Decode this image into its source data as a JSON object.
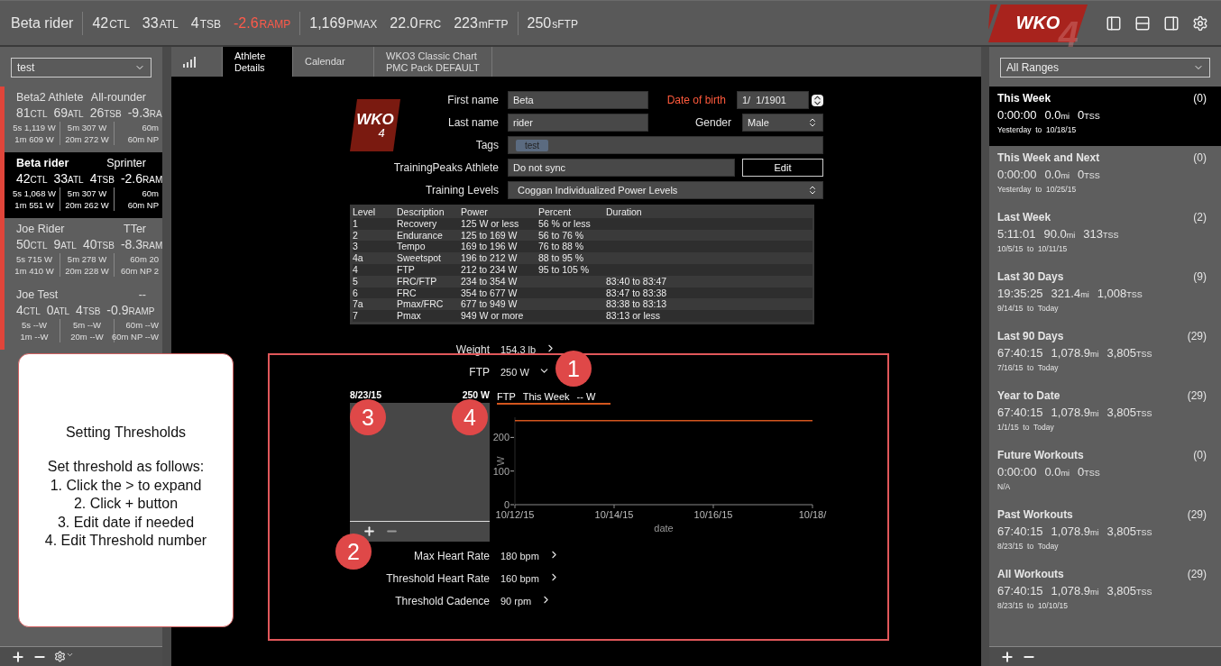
{
  "top_bar": {
    "athlete": "Beta rider",
    "metric_groups": [
      [
        {
          "value": "42",
          "unit": "CTL",
          "alert": false
        },
        {
          "value": "33",
          "unit": "ATL",
          "alert": false
        },
        {
          "value": "4",
          "unit": "TSB",
          "alert": false
        },
        {
          "value": "-2.6",
          "unit": "RAMP",
          "alert": true
        }
      ],
      [
        {
          "value": "1,169",
          "unit": "PMAX",
          "alert": false
        },
        {
          "value": "22.0",
          "unit": "FRC",
          "alert": false
        },
        {
          "value": "223",
          "unit": "mFTP",
          "alert": false
        }
      ],
      [
        {
          "value": "250",
          "unit": "sFTP",
          "alert": false
        }
      ]
    ],
    "logo": {
      "text": "WKO",
      "mark": "4"
    }
  },
  "left_sidebar": {
    "filter": "test",
    "athletes": [
      {
        "name": "Beta2 Athlete",
        "type": "All-rounder",
        "selected": false,
        "stats": [
          {
            "value": "81",
            "unit": "CTL"
          },
          {
            "value": "69",
            "unit": "ATL"
          },
          {
            "value": "26",
            "unit": "TSB"
          },
          {
            "value": "-9.3",
            "unit": "RA"
          }
        ],
        "powers": [
          [
            "5s 1,119 W",
            "1m 609 W"
          ],
          [
            "5m 307 W",
            "20m 272 W"
          ],
          [
            "60m",
            "60m NP"
          ]
        ]
      },
      {
        "name": "Beta rider",
        "type": "Sprinter",
        "selected": true,
        "stats": [
          {
            "value": "42",
            "unit": "CTL"
          },
          {
            "value": "33",
            "unit": "ATL"
          },
          {
            "value": "4",
            "unit": "TSB"
          },
          {
            "value": "-2.6",
            "unit": "RAM"
          }
        ],
        "powers": [
          [
            "5s 1,068 W",
            "1m 551 W"
          ],
          [
            "5m 307 W",
            "20m 262 W"
          ],
          [
            "60m",
            "60m NP"
          ]
        ]
      },
      {
        "name": "Joe Rider",
        "type": "TTer",
        "selected": false,
        "stats": [
          {
            "value": "50",
            "unit": "CTL"
          },
          {
            "value": "9",
            "unit": "ATL"
          },
          {
            "value": "40",
            "unit": "TSB"
          },
          {
            "value": "-8.3",
            "unit": "RAM"
          }
        ],
        "powers": [
          [
            "5s 715 W",
            "1m 410 W"
          ],
          [
            "5m 278 W",
            "20m 228 W"
          ],
          [
            "60m 20",
            "60m NP 2"
          ]
        ]
      },
      {
        "name": "Joe Test",
        "type": "--",
        "selected": false,
        "stats": [
          {
            "value": "4",
            "unit": "CTL"
          },
          {
            "value": "0",
            "unit": "ATL"
          },
          {
            "value": "4",
            "unit": "TSB"
          },
          {
            "value": "-0.9",
            "unit": "RAMP"
          }
        ],
        "powers": [
          [
            "5s --W",
            "1m --W"
          ],
          [
            "5m --W",
            "20m --W"
          ],
          [
            "60m --W",
            "60m NP --W"
          ]
        ]
      }
    ]
  },
  "tabs": [
    {
      "kind": "icon",
      "selected": false
    },
    {
      "kind": "text",
      "label": "Athlete\nDetails",
      "selected": true
    },
    {
      "kind": "text",
      "label": "Calendar",
      "selected": false
    },
    {
      "kind": "text",
      "label": "WKO3 Classic Chart\nPMC Pack DEFAULT",
      "selected": false
    }
  ],
  "athlete_details": {
    "logo": {
      "text": "WKO",
      "mark": "4"
    },
    "first_name": {
      "label": "First name",
      "value": "Beta"
    },
    "date_of_birth": {
      "label": "Date of birth",
      "value": "1/  1/1901"
    },
    "last_name": {
      "label": "Last name",
      "value": "rider"
    },
    "gender": {
      "label": "Gender",
      "value": "Male"
    },
    "tags": {
      "label": "Tags",
      "chips": [
        "test"
      ]
    },
    "trainingpeaks": {
      "label": "TrainingPeaks Athlete",
      "value": "Do not sync",
      "button": "Edit"
    },
    "training_levels": {
      "label": "Training Levels",
      "value": "Coggan Individualized Power Levels"
    },
    "levels_table": {
      "columns": [
        "Level",
        "Description",
        "Power",
        "Percent",
        "Duration"
      ],
      "rows": [
        [
          "1",
          "Recovery",
          "125 W or less",
          "56 % or less",
          ""
        ],
        [
          "2",
          "Endurance",
          "125 to 169 W",
          "56 to 76 %",
          ""
        ],
        [
          "3",
          "Tempo",
          "169 to 196 W",
          "76 to 88 %",
          ""
        ],
        [
          "4a",
          "Sweetspot",
          "196 to 212 W",
          "88 to 95 %",
          ""
        ],
        [
          "4",
          "FTP",
          "212 to 234 W",
          "95 to 105 %",
          ""
        ],
        [
          "5",
          "FRC/FTP",
          "234 to 354 W",
          "",
          "83:40 to 83:47"
        ],
        [
          "6",
          "FRC",
          "354 to 677 W",
          "",
          "83:47 to 83:38"
        ],
        [
          "7a",
          "Pmax/FRC",
          "677 to 949 W",
          "",
          "83:38 to 83:13"
        ],
        [
          "7",
          "Pmax",
          "949 W or more",
          "",
          "83:13 or less"
        ]
      ]
    },
    "weight": {
      "label": "Weight",
      "value": "154.3 lb",
      "expanded": false
    },
    "ftp": {
      "label": "FTP",
      "value": "250 W",
      "expanded": true,
      "history": {
        "date": "8/23/15",
        "value": "250 W"
      },
      "legend": {
        "range": "This Week",
        "value": "-- W"
      },
      "chart_data": {
        "type": "line",
        "xlabel": "date",
        "ylabel": "W",
        "x": [
          "10/12/15",
          "10/14/15",
          "10/16/15",
          "10/18/"
        ],
        "ylim": [
          0,
          260
        ],
        "yticks": [
          0,
          100,
          200
        ],
        "series": [
          {
            "name": "FTP",
            "color": "#d4561e",
            "values": [
              250,
              250,
              250,
              250
            ]
          }
        ]
      }
    },
    "thresholds": [
      {
        "label": "Max Heart Rate",
        "value": "180 bpm",
        "expanded": false
      },
      {
        "label": "Threshold Heart Rate",
        "value": "160 bpm",
        "expanded": false
      },
      {
        "label": "Threshold Cadence",
        "value": "90 rpm",
        "expanded": false
      }
    ]
  },
  "right_sidebar": {
    "filter": "All Ranges",
    "ranges": [
      {
        "title": "This Week",
        "count": "(0)",
        "selected": true,
        "stats": [
          {
            "value": "0:00:00"
          },
          {
            "value": "0.0",
            "unit": "mi"
          },
          {
            "value": "0",
            "unit": "TSS"
          }
        ],
        "dates": "Yesterday  to  10/18/15"
      },
      {
        "title": "This Week and Next",
        "count": "(0)",
        "selected": false,
        "stats": [
          {
            "value": "0:00:00"
          },
          {
            "value": "0.0",
            "unit": "mi"
          },
          {
            "value": "0",
            "unit": "TSS"
          }
        ],
        "dates": "Yesterday  to  10/25/15"
      },
      {
        "title": "Last Week",
        "count": "(2)",
        "selected": false,
        "stats": [
          {
            "value": "5:11:01"
          },
          {
            "value": "90.0",
            "unit": "mi"
          },
          {
            "value": "313",
            "unit": "TSS"
          }
        ],
        "dates": "10/5/15  to  10/11/15"
      },
      {
        "title": "Last 30 Days",
        "count": "(9)",
        "selected": false,
        "stats": [
          {
            "value": "19:35:25"
          },
          {
            "value": "321.4",
            "unit": "mi"
          },
          {
            "value": "1,008",
            "unit": "TSS"
          }
        ],
        "dates": "9/14/15  to  Today"
      },
      {
        "title": "Last 90 Days",
        "count": "(29)",
        "selected": false,
        "stats": [
          {
            "value": "67:40:15"
          },
          {
            "value": "1,078.9",
            "unit": "mi"
          },
          {
            "value": "3,805",
            "unit": "TSS"
          }
        ],
        "dates": "7/16/15  to  Today"
      },
      {
        "title": "Year to Date",
        "count": "(29)",
        "selected": false,
        "stats": [
          {
            "value": "67:40:15"
          },
          {
            "value": "1,078.9",
            "unit": "mi"
          },
          {
            "value": "3,805",
            "unit": "TSS"
          }
        ],
        "dates": "1/1/15  to  Today"
      },
      {
        "title": "Future Workouts",
        "count": "(0)",
        "selected": false,
        "stats": [
          {
            "value": "0:00:00"
          },
          {
            "value": "0.0",
            "unit": "mi"
          },
          {
            "value": "0",
            "unit": "TSS"
          }
        ],
        "dates": "N/A"
      },
      {
        "title": "Past Workouts",
        "count": "(29)",
        "selected": false,
        "stats": [
          {
            "value": "67:40:15"
          },
          {
            "value": "1,078.9",
            "unit": "mi"
          },
          {
            "value": "3,805",
            "unit": "TSS"
          }
        ],
        "dates": "8/23/15  to  Today"
      },
      {
        "title": "All Workouts",
        "count": "(29)",
        "selected": false,
        "stats": [
          {
            "value": "67:40:15"
          },
          {
            "value": "1,078.9",
            "unit": "mi"
          },
          {
            "value": "3,805",
            "unit": "TSS"
          }
        ],
        "dates": "8/23/15  to  10/10/15"
      }
    ]
  },
  "annotation": {
    "callout": {
      "title": "Setting Thresholds",
      "lines": [
        "Set threshold as follows:",
        "1. Click the > to expand",
        "2. Click + button",
        "3. Edit date if needed",
        "4. Edit Threshold number"
      ]
    },
    "markers": [
      "1",
      "2",
      "3",
      "4"
    ]
  }
}
